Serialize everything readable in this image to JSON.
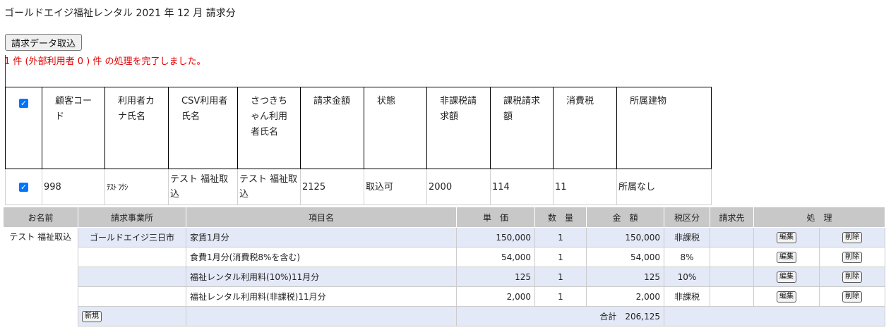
{
  "page": {
    "title": "ゴールドエイジ福祉レンタル 2021 年 12 月 請求分",
    "import_button": "請求データ取込",
    "status_message": "1 件 (外部利用者 0 ) 件 の処理を完了しました。"
  },
  "import_table": {
    "headers": [
      "顧客コード",
      "利用者カナ氏名",
      "CSV利用者氏名",
      "さつきちゃん利用者氏名",
      "請求金額",
      "状態",
      "非課税請求額",
      "課税請求額",
      "消費税",
      "所属建物"
    ],
    "rows": [
      {
        "checked": true,
        "code": "998",
        "kana": "ﾃｽﾄ ﾌｸｼ",
        "csv_name": "テスト 福祉取込",
        "satsuki_name": "テスト 福祉取込",
        "amount": "2125",
        "state": "取込可",
        "nontax": "2000",
        "tax": "114",
        "consumption_tax": "11",
        "building": "所属なし"
      }
    ]
  },
  "bill_table": {
    "headers": [
      "お名前",
      "請求事業所",
      "項目名",
      "単　価",
      "数　量",
      "金　額",
      "税区分",
      "請求先",
      "処　理"
    ],
    "customer_name": "テスト 福祉取込",
    "office": "ゴールドエイジ三日市",
    "rows": [
      {
        "item": "家賃1月分",
        "price": "150,000",
        "qty": "1",
        "amount": "150,000",
        "tax_class": "非課税"
      },
      {
        "item": "食費1月分(消費税8%を含む)",
        "price": "54,000",
        "qty": "1",
        "amount": "54,000",
        "tax_class": "8%"
      },
      {
        "item": "福祉レンタル利用料(10%)11月分",
        "price": "125",
        "qty": "1",
        "amount": "125",
        "tax_class": "10%"
      },
      {
        "item": "福祉レンタル利用料(非課税)11月分",
        "price": "2,000",
        "qty": "1",
        "amount": "2,000",
        "tax_class": "非課税"
      }
    ],
    "edit_label": "編集",
    "delete_label": "削除",
    "new_label": "新規",
    "total_label": "合計",
    "total_value": "206,125"
  },
  "colors": {
    "accent": "#0075ff",
    "status": "#e00000",
    "band": "#e4e9f7",
    "header_bg": "#c8c8c8"
  }
}
